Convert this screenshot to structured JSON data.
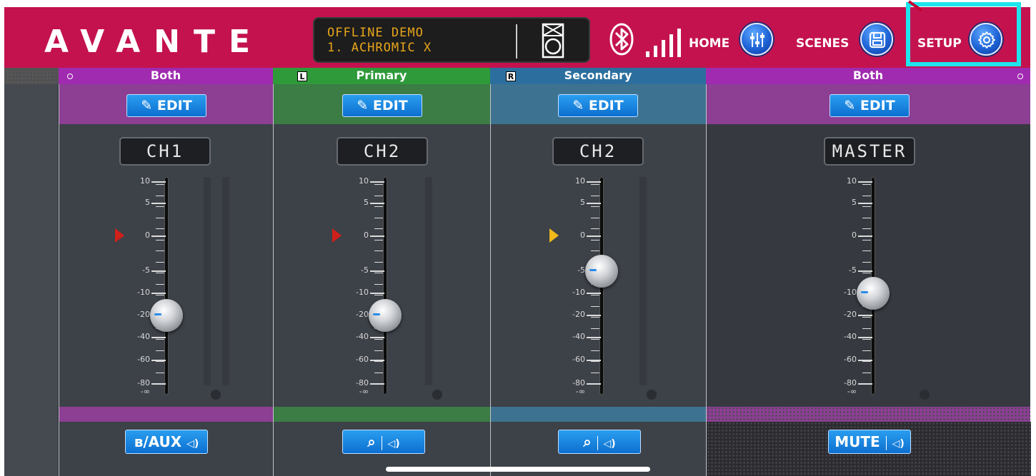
{
  "header": {
    "logo": "AVANTE",
    "display_line1": "OFFLINE DEMO",
    "display_line2": "1. ACHROMIC X",
    "home_label": "HOME",
    "scenes_label": "SCENES",
    "setup_label": "SETUP",
    "background_color": "#c4124f",
    "highlight_color": "#1ee5ee"
  },
  "label_bar": {
    "segments": [
      {
        "label": "Both",
        "tag": "",
        "color": "#a02ab0"
      },
      {
        "label": "Primary",
        "tag": "L",
        "color": "#2f9a3a"
      },
      {
        "label": "Secondary",
        "tag": "R",
        "color": "#2c6f9e"
      },
      {
        "label": "Both",
        "tag": "",
        "color": "#a02ab0"
      }
    ]
  },
  "fader_scale": [
    "10",
    "5",
    "0",
    "-5",
    "-10",
    "-20",
    "-40",
    "-60",
    "-80",
    "-∞"
  ],
  "channels": [
    {
      "edit_label": "EDIT",
      "name": "CH1",
      "footer_label": "/AUX",
      "footer_type": "bluetooth-aux",
      "fader_level_db": "-20",
      "accent": "#8c3f93",
      "marker_color": "#d0201a"
    },
    {
      "edit_label": "EDIT",
      "name": "CH2",
      "footer_label": "",
      "footer_type": "microphone",
      "fader_level_db": "-20",
      "accent": "#3b7d44",
      "marker_color": "#d0201a"
    },
    {
      "edit_label": "EDIT",
      "name": "CH2",
      "footer_label": "",
      "footer_type": "microphone",
      "fader_level_db": "-5",
      "accent": "#3d7390",
      "marker_color": "#f0b81a"
    },
    {
      "edit_label": "EDIT",
      "name": "MASTER",
      "footer_label": "MUTE",
      "footer_type": "mute",
      "fader_level_db": "-10",
      "accent": "#8c3f93",
      "marker_color": ""
    }
  ]
}
